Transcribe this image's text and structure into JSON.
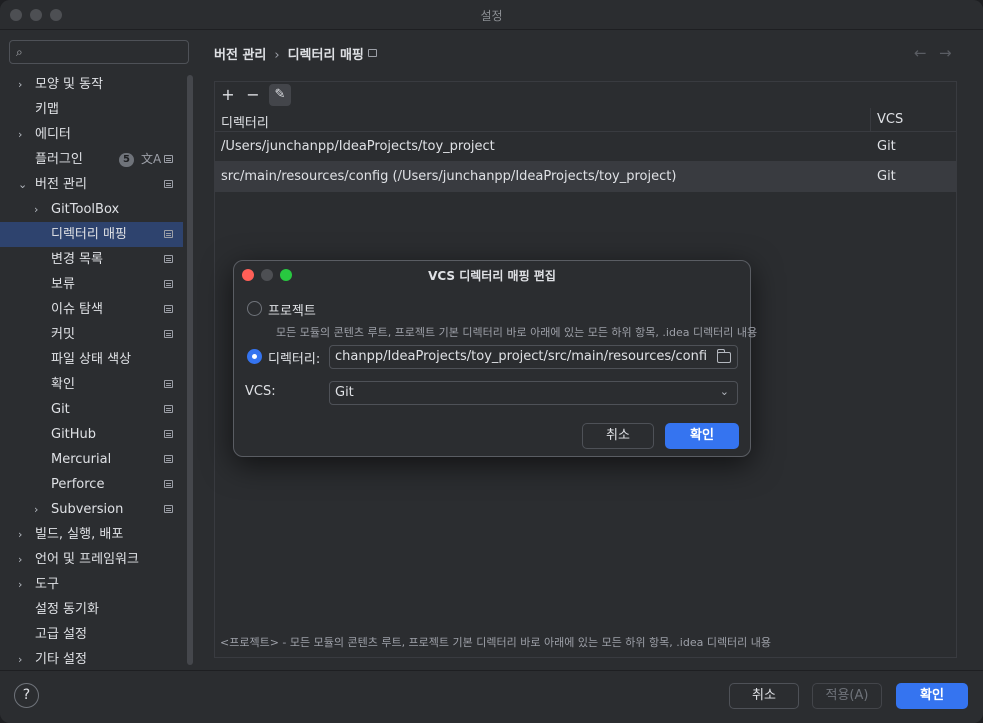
{
  "window": {
    "title": "설정"
  },
  "sidebar": {
    "search_placeholder": "",
    "items": [
      {
        "label": "모양 및 동작",
        "expandable": true
      },
      {
        "label": "키맵",
        "expandable": false
      },
      {
        "label": "에디터",
        "expandable": true
      },
      {
        "label": "플러그인",
        "expandable": false,
        "badge": "5"
      },
      {
        "label": "버전 관리",
        "expandable": true,
        "expanded": true
      },
      {
        "label": "GitToolBox",
        "expandable": true
      },
      {
        "label": "디렉터리 매핑",
        "selected": true
      },
      {
        "label": "변경 목록"
      },
      {
        "label": "보류"
      },
      {
        "label": "이슈 탐색"
      },
      {
        "label": "커밋"
      },
      {
        "label": "파일 상태 색상"
      },
      {
        "label": "확인"
      },
      {
        "label": "Git"
      },
      {
        "label": "GitHub"
      },
      {
        "label": "Mercurial"
      },
      {
        "label": "Perforce"
      },
      {
        "label": "Subversion",
        "expandable": true
      },
      {
        "label": "빌드, 실행, 배포",
        "expandable": true
      },
      {
        "label": "언어 및 프레임워크",
        "expandable": true
      },
      {
        "label": "도구",
        "expandable": true
      },
      {
        "label": "설정 동기화"
      },
      {
        "label": "고급 설정"
      },
      {
        "label": "기타 설정",
        "expandable": true
      }
    ]
  },
  "main": {
    "breadcrumb": {
      "parent": "버전 관리",
      "separator": "›",
      "current": "디렉터리 매핑"
    },
    "table": {
      "columns": [
        "디렉터리",
        "VCS"
      ],
      "rows": [
        {
          "directory": "/Users/junchanpp/IdeaProjects/toy_project",
          "vcs": "Git"
        },
        {
          "directory": "src/main/resources/config (/Users/junchanpp/IdeaProjects/toy_project)",
          "vcs": "Git"
        }
      ]
    },
    "footer_note": "<프로젝트> - 모든 모듈의 콘텐츠 루트, 프로젝트 기본 디렉터리 바로 아래에 있는 모든 하위 항목, .idea 디렉터리 내용"
  },
  "dialog": {
    "title": "VCS 디렉터리 매핑 편집",
    "option_project": "프로젝트",
    "option_project_desc": "모든 모듈의 콘텐츠 루트, 프로젝트 기본 디렉터리 바로 아래에 있는 모든 하위 항목, .idea 디렉터리 내용",
    "option_directory": "디렉터리:",
    "directory_value": "chanpp/IdeaProjects/toy_project/src/main/resources/config",
    "vcs_label": "VCS:",
    "vcs_value": "Git",
    "cancel": "취소",
    "ok": "확인"
  },
  "bottom": {
    "help": "?",
    "cancel": "취소",
    "apply": "적용(A)",
    "ok": "확인"
  },
  "colors": {
    "accent": "#3574f0",
    "selection": "#2e436e",
    "background": "#2b2d30"
  }
}
